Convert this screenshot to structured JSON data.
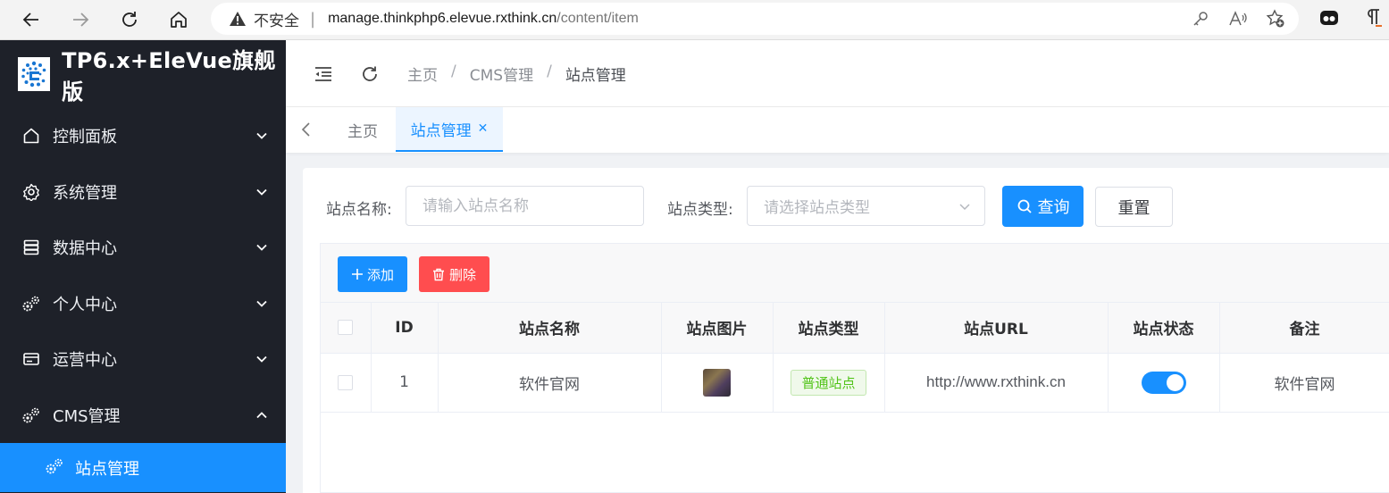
{
  "browser": {
    "security_label": "不安全",
    "url_host": "manage.thinkphp6.elevue.rxthink.cn",
    "url_path": "/content/item"
  },
  "sidebar": {
    "app_title": "TP6.x+EleVue旗舰版",
    "items": [
      {
        "label": "控制面板",
        "icon": "home-icon",
        "expanded": false
      },
      {
        "label": "系统管理",
        "icon": "gear-icon",
        "expanded": false
      },
      {
        "label": "数据中心",
        "icon": "database-icon",
        "expanded": false
      },
      {
        "label": "个人中心",
        "icon": "cogs-icon",
        "expanded": false
      },
      {
        "label": "运营中心",
        "icon": "card-icon",
        "expanded": false
      },
      {
        "label": "CMS管理",
        "icon": "cogs-icon",
        "expanded": true
      }
    ],
    "submenu": [
      {
        "label": "站点管理",
        "icon": "cogs-icon",
        "active": true
      }
    ]
  },
  "header": {
    "breadcrumb": [
      "主页",
      "CMS管理",
      "站点管理"
    ],
    "separator": "/"
  },
  "tabs": {
    "home_label": "主页",
    "active_label": "站点管理"
  },
  "search": {
    "name_label": "站点名称:",
    "name_placeholder": "请输入站点名称",
    "type_label": "站点类型:",
    "type_placeholder": "请选择站点类型",
    "query_label": "查询",
    "reset_label": "重置"
  },
  "toolbar": {
    "add_label": "添加",
    "delete_label": "删除"
  },
  "table": {
    "columns": [
      "ID",
      "站点名称",
      "站点图片",
      "站点类型",
      "站点URL",
      "站点状态",
      "备注"
    ],
    "rows": [
      {
        "id": "1",
        "name": "软件官网",
        "type": "普通站点",
        "url": "http://www.rxthink.cn",
        "status_on": true,
        "note": "软件官网"
      }
    ]
  },
  "colors": {
    "primary": "#1890ff",
    "danger": "#ff4d4f",
    "sidebar_bg": "#1e2129",
    "success": "#52c41a"
  }
}
